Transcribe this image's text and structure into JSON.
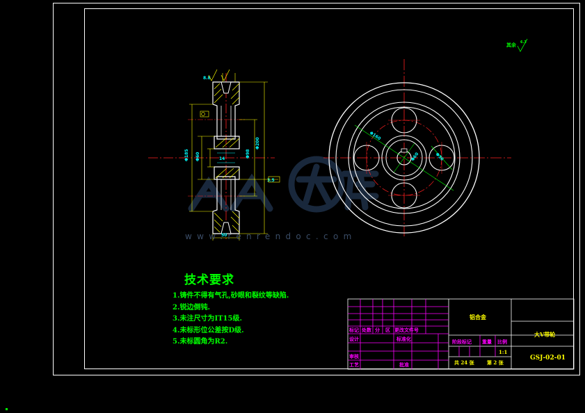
{
  "drawing": {
    "tech_requirements": {
      "title": "技术要求",
      "items": [
        "1.铸件不得有气孔,砂眼和裂纹等缺陷.",
        "2.锐边倒钝.",
        "3.未注尺寸为IT15级.",
        "4.未标形位公差按D级.",
        "5.未标圆角为R2."
      ]
    },
    "watermark": {
      "text": "www.renrendoc.com"
    },
    "title_block": {
      "material": "铝合金",
      "part_name": "大V带轮",
      "drawing_no": "GSJ-02-01",
      "scale_value": "1:1",
      "total_sheets": "共 24 张",
      "sheet_no": "第 2 张",
      "headers": {
        "mark": "标记",
        "count": "处数",
        "zone": "分",
        "zone2": "区",
        "change_doc": "更改文件号",
        "design": "设计",
        "standardize": "标准化",
        "stage_mark": "阶段标记",
        "weight": "重量",
        "scale": "比例",
        "review": "审核",
        "process": "工艺",
        "approve": "批准"
      }
    },
    "annotations": {
      "roughness_other": "其余"
    }
  }
}
